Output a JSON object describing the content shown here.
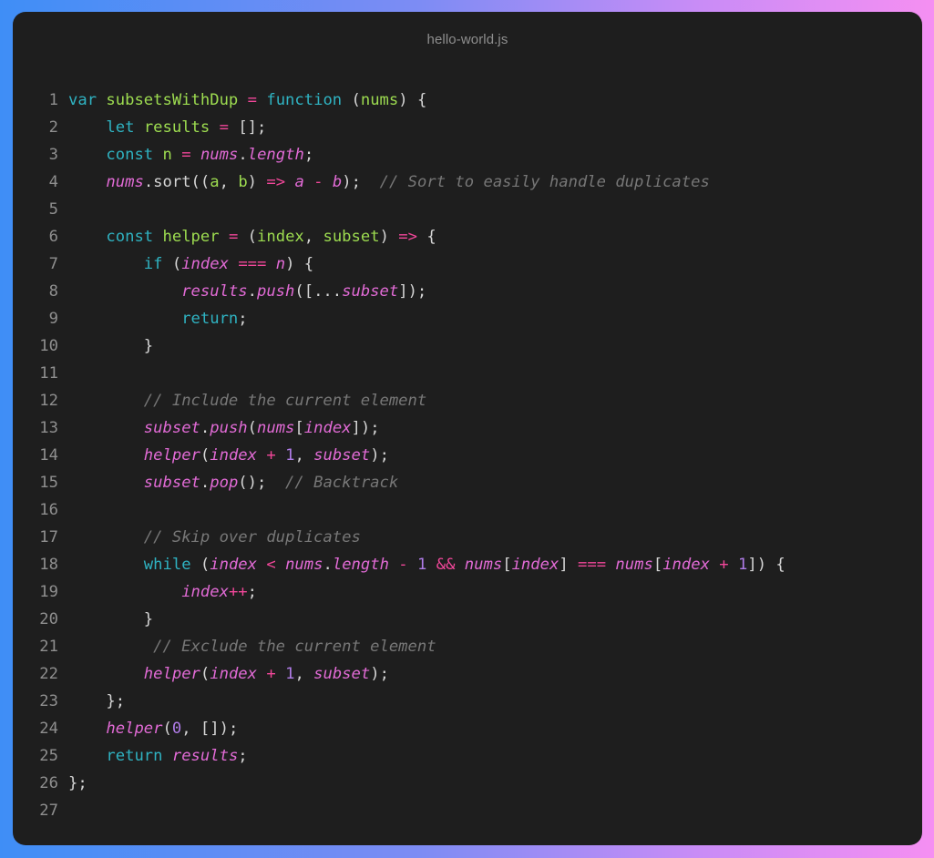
{
  "editor": {
    "filename": "hello-world.js",
    "colors": {
      "background": "#1e1e1e",
      "keyword": "#2fb3c2",
      "function_name": "#9ddc50",
      "operator": "#f2479a",
      "variable": "#e26bd6",
      "comment": "#777777",
      "number": "#b07ce8"
    },
    "lines": [
      {
        "no": "1",
        "tokens": [
          [
            "kw",
            "var"
          ],
          [
            "p",
            " "
          ],
          [
            "fn",
            "subsetsWithDup"
          ],
          [
            "p",
            " "
          ],
          [
            "op",
            "="
          ],
          [
            "p",
            " "
          ],
          [
            "kw",
            "function"
          ],
          [
            "p",
            " ("
          ],
          [
            "ex",
            "nums"
          ],
          [
            "p",
            ") {"
          ]
        ]
      },
      {
        "no": "2",
        "tokens": [
          [
            "p",
            "    "
          ],
          [
            "kw",
            "let"
          ],
          [
            "p",
            " "
          ],
          [
            "fn",
            "results"
          ],
          [
            "p",
            " "
          ],
          [
            "op",
            "="
          ],
          [
            "p",
            " [];"
          ]
        ]
      },
      {
        "no": "3",
        "tokens": [
          [
            "p",
            "    "
          ],
          [
            "kw",
            "const"
          ],
          [
            "p",
            " "
          ],
          [
            "fn",
            "n"
          ],
          [
            "p",
            " "
          ],
          [
            "op",
            "="
          ],
          [
            "p",
            " "
          ],
          [
            "v",
            "nums"
          ],
          [
            "p",
            "."
          ],
          [
            "v",
            "length"
          ],
          [
            "p",
            ";"
          ]
        ]
      },
      {
        "no": "4",
        "tokens": [
          [
            "p",
            "    "
          ],
          [
            "v",
            "nums"
          ],
          [
            "p",
            ".sort(("
          ],
          [
            "ex",
            "a"
          ],
          [
            "p",
            ", "
          ],
          [
            "ex",
            "b"
          ],
          [
            "p",
            ") "
          ],
          [
            "op",
            "=>"
          ],
          [
            "p",
            " "
          ],
          [
            "v",
            "a"
          ],
          [
            "p",
            " "
          ],
          [
            "op",
            "-"
          ],
          [
            "p",
            " "
          ],
          [
            "v",
            "b"
          ],
          [
            "p",
            ");  "
          ],
          [
            "c",
            "// Sort to easily handle duplicates"
          ]
        ]
      },
      {
        "no": "5",
        "tokens": []
      },
      {
        "no": "6",
        "tokens": [
          [
            "p",
            "    "
          ],
          [
            "kw",
            "const"
          ],
          [
            "p",
            " "
          ],
          [
            "fn",
            "helper"
          ],
          [
            "p",
            " "
          ],
          [
            "op",
            "="
          ],
          [
            "p",
            " ("
          ],
          [
            "ex",
            "index"
          ],
          [
            "p",
            ", "
          ],
          [
            "ex",
            "subset"
          ],
          [
            "p",
            ") "
          ],
          [
            "op",
            "=>"
          ],
          [
            "p",
            " {"
          ]
        ]
      },
      {
        "no": "7",
        "tokens": [
          [
            "p",
            "        "
          ],
          [
            "kw",
            "if"
          ],
          [
            "p",
            " ("
          ],
          [
            "v",
            "index"
          ],
          [
            "p",
            " "
          ],
          [
            "op",
            "==="
          ],
          [
            "p",
            " "
          ],
          [
            "v",
            "n"
          ],
          [
            "p",
            ") {"
          ]
        ]
      },
      {
        "no": "8",
        "tokens": [
          [
            "p",
            "            "
          ],
          [
            "v",
            "results"
          ],
          [
            "p",
            "."
          ],
          [
            "v",
            "push"
          ],
          [
            "p",
            "([..."
          ],
          [
            "v",
            "subset"
          ],
          [
            "p",
            "]);"
          ]
        ]
      },
      {
        "no": "9",
        "tokens": [
          [
            "p",
            "            "
          ],
          [
            "kw",
            "return"
          ],
          [
            "p",
            ";"
          ]
        ]
      },
      {
        "no": "10",
        "tokens": [
          [
            "p",
            "        }"
          ]
        ]
      },
      {
        "no": "11",
        "tokens": []
      },
      {
        "no": "12",
        "tokens": [
          [
            "p",
            "        "
          ],
          [
            "c",
            "// Include the current element"
          ]
        ]
      },
      {
        "no": "13",
        "tokens": [
          [
            "p",
            "        "
          ],
          [
            "v",
            "subset"
          ],
          [
            "p",
            "."
          ],
          [
            "v",
            "push"
          ],
          [
            "p",
            "("
          ],
          [
            "v",
            "nums"
          ],
          [
            "p",
            "["
          ],
          [
            "v",
            "index"
          ],
          [
            "p",
            "]);"
          ]
        ]
      },
      {
        "no": "14",
        "tokens": [
          [
            "p",
            "        "
          ],
          [
            "v",
            "helper"
          ],
          [
            "p",
            "("
          ],
          [
            "v",
            "index"
          ],
          [
            "p",
            " "
          ],
          [
            "op",
            "+"
          ],
          [
            "p",
            " "
          ],
          [
            "n",
            "1"
          ],
          [
            "p",
            ", "
          ],
          [
            "v",
            "subset"
          ],
          [
            "p",
            ");"
          ]
        ]
      },
      {
        "no": "15",
        "tokens": [
          [
            "p",
            "        "
          ],
          [
            "v",
            "subset"
          ],
          [
            "p",
            "."
          ],
          [
            "v",
            "pop"
          ],
          [
            "p",
            "();  "
          ],
          [
            "c",
            "// Backtrack"
          ]
        ]
      },
      {
        "no": "16",
        "tokens": []
      },
      {
        "no": "17",
        "tokens": [
          [
            "p",
            "        "
          ],
          [
            "c",
            "// Skip over duplicates"
          ]
        ]
      },
      {
        "no": "18",
        "tokens": [
          [
            "p",
            "        "
          ],
          [
            "kw",
            "while"
          ],
          [
            "p",
            " ("
          ],
          [
            "v",
            "index"
          ],
          [
            "p",
            " "
          ],
          [
            "op",
            "<"
          ],
          [
            "p",
            " "
          ],
          [
            "v",
            "nums"
          ],
          [
            "p",
            "."
          ],
          [
            "v",
            "length"
          ],
          [
            "p",
            " "
          ],
          [
            "op",
            "-"
          ],
          [
            "p",
            " "
          ],
          [
            "n",
            "1"
          ],
          [
            "p",
            " "
          ],
          [
            "op",
            "&&"
          ],
          [
            "p",
            " "
          ],
          [
            "v",
            "nums"
          ],
          [
            "p",
            "["
          ],
          [
            "v",
            "index"
          ],
          [
            "p",
            "] "
          ],
          [
            "op",
            "==="
          ],
          [
            "p",
            " "
          ],
          [
            "v",
            "nums"
          ],
          [
            "p",
            "["
          ],
          [
            "v",
            "index"
          ],
          [
            "p",
            " "
          ],
          [
            "op",
            "+"
          ],
          [
            "p",
            " "
          ],
          [
            "n",
            "1"
          ],
          [
            "p",
            "]) {"
          ]
        ]
      },
      {
        "no": "19",
        "tokens": [
          [
            "p",
            "            "
          ],
          [
            "v",
            "index"
          ],
          [
            "op",
            "++"
          ],
          [
            "p",
            ";"
          ]
        ]
      },
      {
        "no": "20",
        "tokens": [
          [
            "p",
            "        }"
          ]
        ]
      },
      {
        "no": "21",
        "tokens": [
          [
            "p",
            "         "
          ],
          [
            "c",
            "// Exclude the current element"
          ]
        ]
      },
      {
        "no": "22",
        "tokens": [
          [
            "p",
            "        "
          ],
          [
            "v",
            "helper"
          ],
          [
            "p",
            "("
          ],
          [
            "v",
            "index"
          ],
          [
            "p",
            " "
          ],
          [
            "op",
            "+"
          ],
          [
            "p",
            " "
          ],
          [
            "n",
            "1"
          ],
          [
            "p",
            ", "
          ],
          [
            "v",
            "subset"
          ],
          [
            "p",
            ");"
          ]
        ]
      },
      {
        "no": "23",
        "tokens": [
          [
            "p",
            "    };"
          ]
        ]
      },
      {
        "no": "24",
        "tokens": [
          [
            "p",
            "    "
          ],
          [
            "v",
            "helper"
          ],
          [
            "p",
            "("
          ],
          [
            "n",
            "0"
          ],
          [
            "p",
            ", []);"
          ]
        ]
      },
      {
        "no": "25",
        "tokens": [
          [
            "p",
            "    "
          ],
          [
            "kw",
            "return"
          ],
          [
            "p",
            " "
          ],
          [
            "v",
            "results"
          ],
          [
            "p",
            ";"
          ]
        ]
      },
      {
        "no": "26",
        "tokens": [
          [
            "p",
            "};"
          ]
        ]
      },
      {
        "no": "27",
        "tokens": []
      }
    ]
  }
}
